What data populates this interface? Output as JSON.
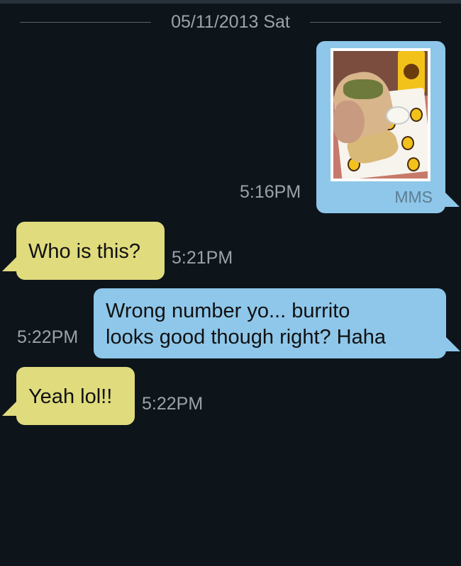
{
  "date_header": "05/11/2013 Sat",
  "colors": {
    "background": "#0d151b",
    "sent_bubble": "#8ec7ea",
    "received_bubble": "#e0db7d",
    "timestamp_text": "#9aa3a9"
  },
  "messages": [
    {
      "direction": "sent",
      "type": "mms",
      "attachment_label": "MMS",
      "image": "burrito-photo",
      "time": "5:16PM"
    },
    {
      "direction": "received",
      "type": "text",
      "text": "Who is this?",
      "time": "5:21PM"
    },
    {
      "direction": "sent",
      "type": "text",
      "lines": [
        "Wrong number yo... burrito",
        "looks good though right? Haha"
      ],
      "time": "5:22PM"
    },
    {
      "direction": "received",
      "type": "text",
      "text": "Yeah lol!!",
      "time": "5:22PM"
    }
  ]
}
